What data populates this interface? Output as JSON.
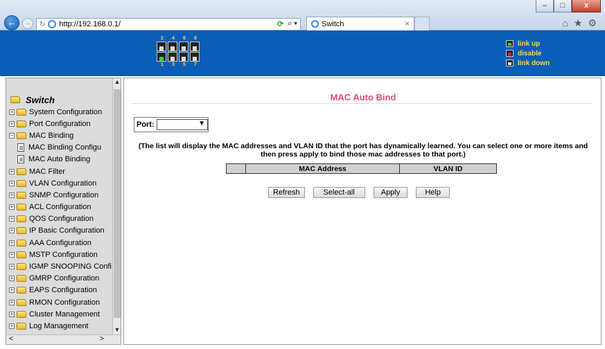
{
  "browser": {
    "address_url": "http://192.168.0.1/",
    "tab_title": "Switch",
    "tab_close": "×",
    "window_buttons": [
      "–",
      "□",
      "x"
    ]
  },
  "banner": {
    "port_numbers_top": [
      "2",
      "4",
      "6",
      "8"
    ],
    "port_numbers_bottom": [
      "1",
      "3",
      "5",
      "7"
    ],
    "legend": {
      "link_up": "link up",
      "disable": "disable",
      "link_down": "link down"
    }
  },
  "sidebar": {
    "root": "Switch",
    "items": [
      "System Configuration",
      "Port Configuration",
      "MAC Binding",
      "MAC Binding Configu",
      "MAC Auto Binding",
      "MAC Filter",
      "VLAN Configuration",
      "SNMP Configuration",
      "ACL Configuration",
      "QOS Configuration",
      "IP Basic Configuration",
      "AAA Configuration",
      "MSTP Configuration",
      "IGMP SNOOPING Confi",
      "GMRP Configuration",
      "EAPS Configuration",
      "RMON Configuration",
      "Cluster Management",
      "Log Management"
    ]
  },
  "main": {
    "title": "MAC Auto Bind",
    "port_label": "Port:",
    "port_value": "",
    "description": "(The list will display the MAC addresses and VLAN ID that the port has dynamically learned. You can select one or more items and then press apply to bind those mac addresses to that port.)",
    "table_headers": [
      "",
      "MAC Address",
      "VLAN ID"
    ],
    "buttons": {
      "refresh": "Refresh",
      "select_all": "Select-all",
      "apply": "Apply",
      "help": "Help"
    }
  }
}
